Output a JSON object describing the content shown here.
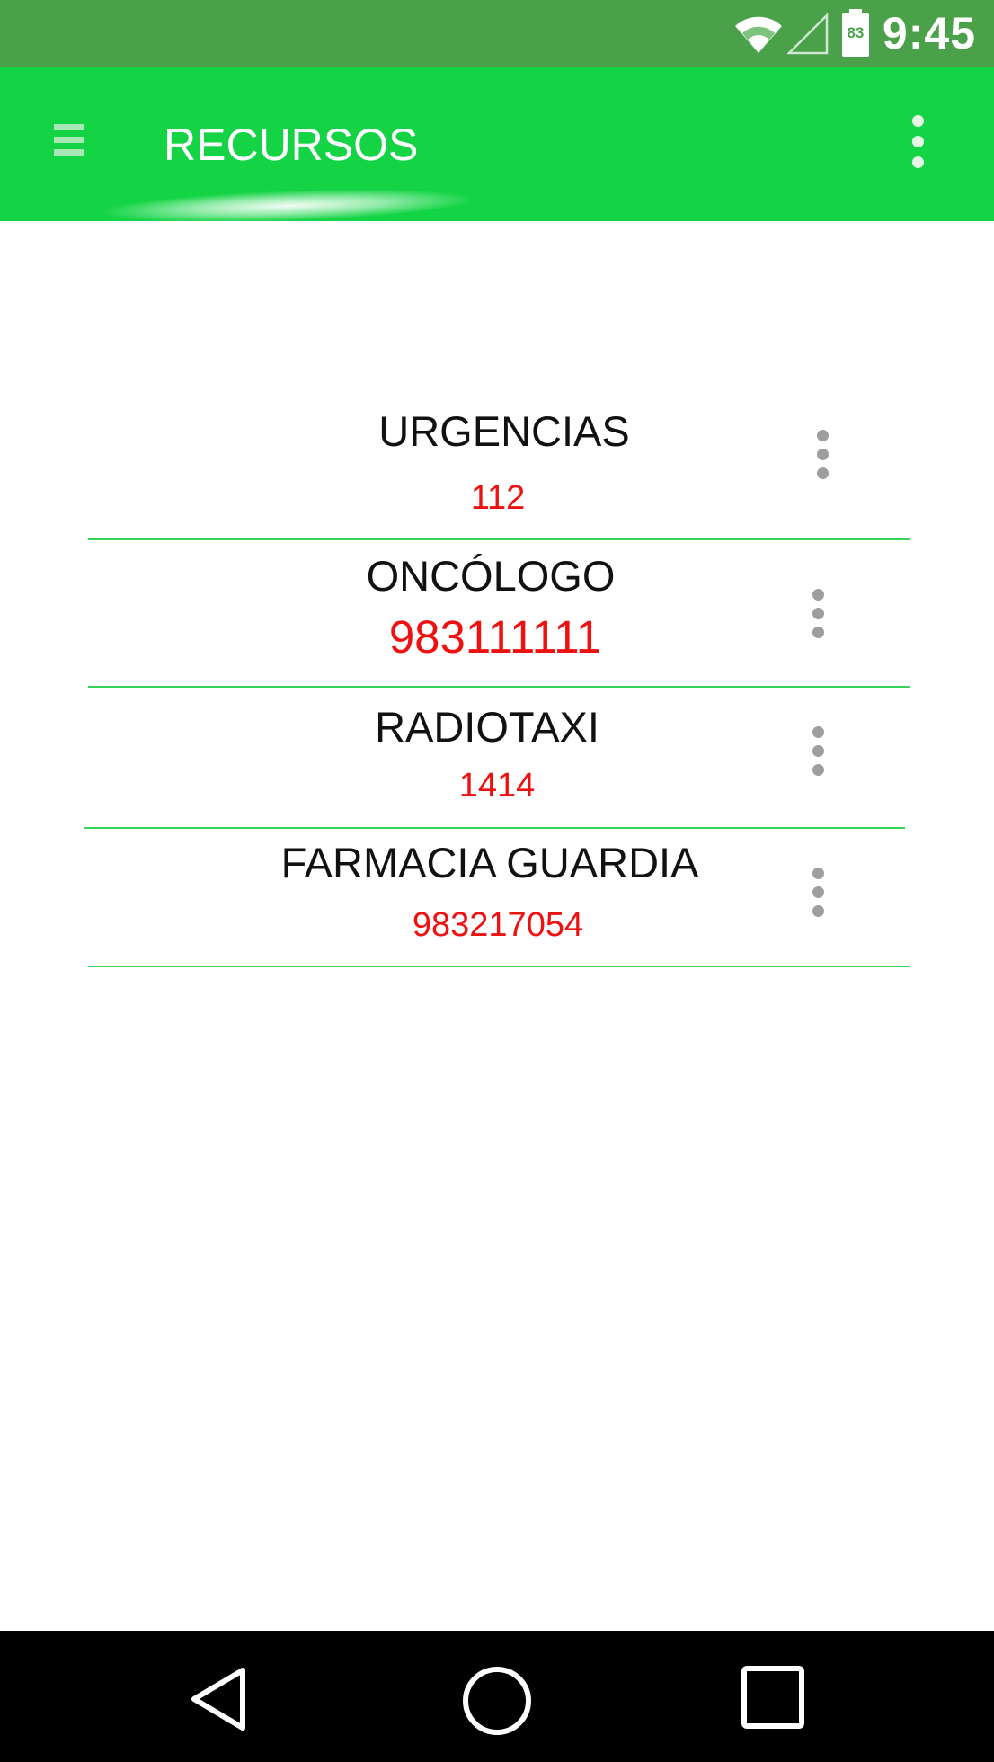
{
  "status_bar": {
    "time": "9:45",
    "battery_level": "83",
    "icons": [
      "wifi-icon",
      "signal-icon",
      "battery-icon"
    ]
  },
  "app_bar": {
    "title": "RECURSOS",
    "menu_icon": "hamburger-menu-icon",
    "overflow_icon": "more-vertical-icon"
  },
  "resources": [
    {
      "name": "URGENCIAS",
      "phone": "112"
    },
    {
      "name": "ONCÓLOGO",
      "phone": "983111111"
    },
    {
      "name": "RADIOTAXI",
      "phone": "1414"
    },
    {
      "name": "FARMACIA GUARDIA",
      "phone": "983217054"
    }
  ],
  "nav_bar": {
    "icons": [
      "back-icon",
      "home-icon",
      "recents-icon"
    ]
  },
  "colors": {
    "status_bar": "#4aa14a",
    "app_bar": "#14d445",
    "phone_text": "#ee1111",
    "divider": "#37d45a",
    "nav_bar": "#000000"
  }
}
